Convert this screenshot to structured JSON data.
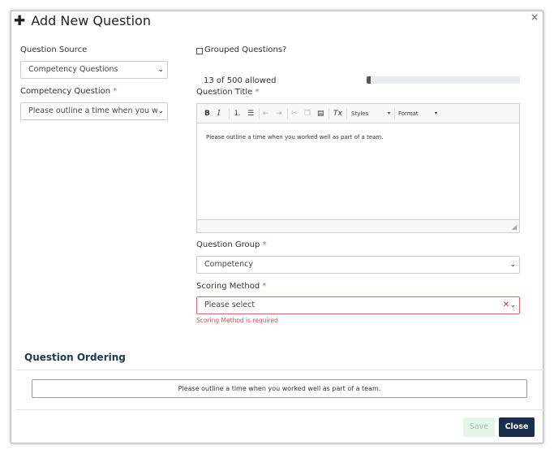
{
  "modal": {
    "title": "Add New Question",
    "close_glyph": "×"
  },
  "question_source": {
    "label": "Question Source",
    "value": "Competency Questions"
  },
  "competency_question": {
    "label": "Competency Question",
    "required_mark": "*",
    "value": "Please outline a time when you w"
  },
  "grouped": {
    "label": "Grouped Questions?",
    "checked": false
  },
  "char_count": {
    "text": "13 of 500 allowed",
    "progress_fraction": 0.026
  },
  "question_title": {
    "label": "Question Title",
    "required_mark": "*",
    "content": "Please outline a time when you worked well as part of a team."
  },
  "editor_toolbar": {
    "bold": "B",
    "italic": "I",
    "styles": "Styles",
    "format": "Format",
    "remove_format": "Tx"
  },
  "question_group": {
    "label": "Question Group",
    "required_mark": "*",
    "value": "Competency"
  },
  "scoring_method": {
    "label": "Scoring Method",
    "required_mark": "*",
    "value": "Please select",
    "error": "Scoring Method is required"
  },
  "ordering": {
    "heading": "Question Ordering",
    "items": [
      "Please outline a time when you worked well as part of a team."
    ]
  },
  "footer": {
    "save": "Save",
    "close": "Close"
  },
  "colors": {
    "primary": "#192e4b",
    "error": "#d9534f",
    "save_bg": "#e5f5ea"
  }
}
